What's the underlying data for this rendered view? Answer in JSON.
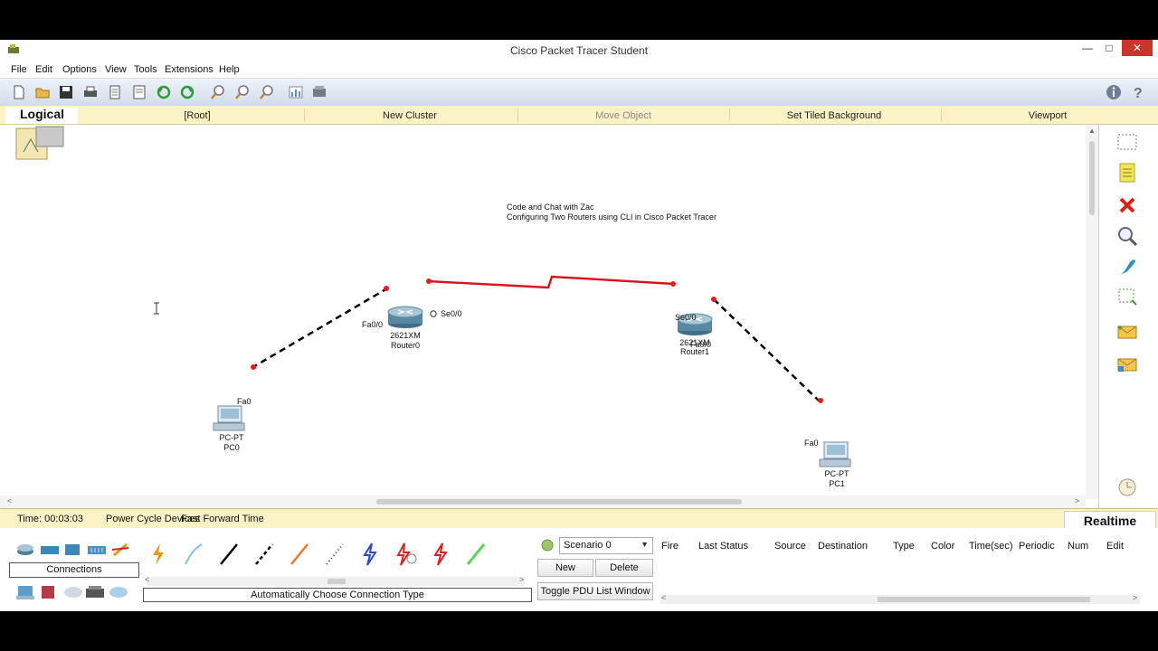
{
  "window": {
    "title": "Cisco Packet Tracer Student",
    "controls": {
      "minimize": "—",
      "maximize": "□",
      "close": "✕"
    }
  },
  "menu": [
    "File",
    "Edit",
    "Options",
    "View",
    "Tools",
    "Extensions",
    "Help"
  ],
  "navbar": {
    "mode": "Logical",
    "root": "[Root]",
    "new_cluster": "New Cluster",
    "move_object": "Move Object",
    "set_tiled_background": "Set Tiled Background",
    "viewport": "Viewport"
  },
  "note": {
    "line1": "Code and Chat with Zac",
    "line2": "Configuring Two Routers using CLI in Cisco Packet Tracer"
  },
  "devices": {
    "router0": {
      "model": "2621XM",
      "name": "Router0",
      "port_fa": "Fa0/0",
      "port_se": "Se0/0"
    },
    "router1": {
      "model": "2621XM",
      "name": "Router1",
      "port_fa": "Fa0/0",
      "port_se": "Se0/0"
    },
    "pc0": {
      "model": "PC-PT",
      "name": "PC0",
      "port": "Fa0"
    },
    "pc1": {
      "model": "PC-PT",
      "name": "PC1",
      "port": "Fa0"
    }
  },
  "statusbar": {
    "time": "Time: 00:03:03",
    "power_cycle": "Power Cycle Devices",
    "fast_forward": "Fast Forward Time",
    "mode": "Realtime"
  },
  "bottom": {
    "category_label": "Connections",
    "connection_hint": "Automatically Choose Connection Type",
    "scenario": {
      "selected": "Scenario 0",
      "new": "New",
      "delete": "Delete",
      "toggle": "Toggle PDU List Window"
    },
    "pdu_headers": [
      "Fire",
      "Last Status",
      "Source",
      "Destination",
      "Type",
      "Color",
      "Time(sec)",
      "Periodic",
      "Num",
      "Edit"
    ]
  },
  "colors": {
    "serial_link": "#d9131a",
    "nav_bg": "#fbf3c6",
    "close_button": "#c7352b"
  },
  "icons": {
    "toolbar": [
      "new-file-icon",
      "open-folder-icon",
      "save-icon",
      "print-icon",
      "activity-wizard-icon",
      "custom-pdu-icon",
      "undo-icon",
      "redo-icon",
      "zoom-in-icon",
      "zoom-reset-icon",
      "zoom-out-icon",
      "palette-icon",
      "custom-device-icon"
    ],
    "right": [
      "select-icon",
      "note-icon",
      "delete-icon",
      "inspect-icon",
      "draw-icon",
      "resize-icon",
      "simple-pdu-icon",
      "complex-pdu-icon"
    ]
  }
}
